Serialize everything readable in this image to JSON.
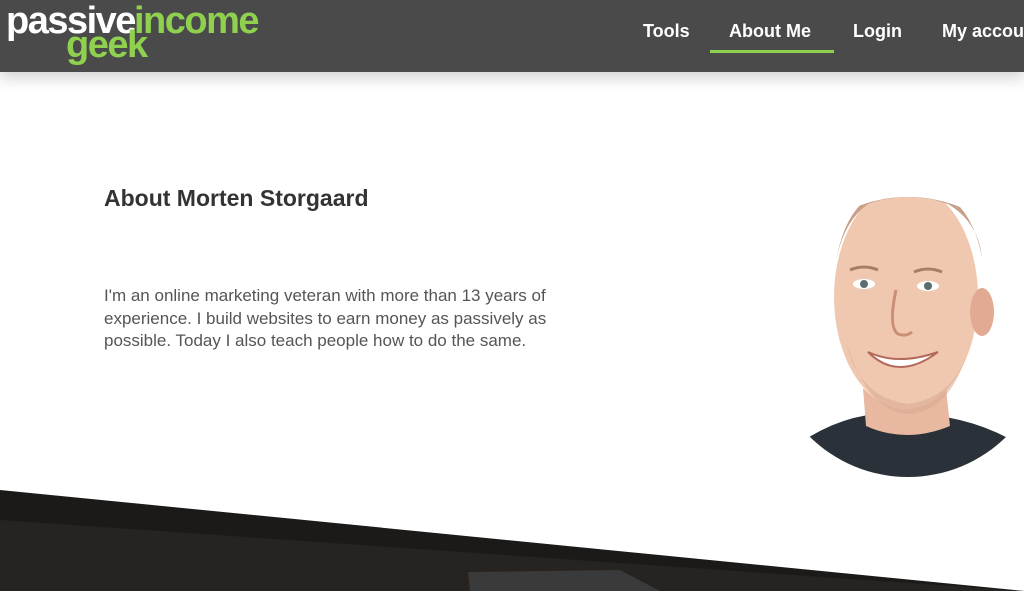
{
  "logo": {
    "word1": "passive",
    "word2": "income",
    "word3": "geek"
  },
  "nav": {
    "items": [
      {
        "label": "Tools"
      },
      {
        "label": "About Me"
      },
      {
        "label": "Login"
      },
      {
        "label": "My accou"
      }
    ],
    "active": "About Me"
  },
  "page": {
    "title": "About Morten Storgaard",
    "bio": "I'm an online marketing veteran with more than 13 years of experience. I build websites to earn money as passively as possible. Today I also teach people how to do the same."
  },
  "colors": {
    "header_bg": "#4a4a4a",
    "accent_green": "#8fd14f",
    "title_text": "#333333",
    "body_text": "#555555",
    "footer_dark": "#1c1a18"
  },
  "icons": {
    "avatar": "author-portrait"
  }
}
